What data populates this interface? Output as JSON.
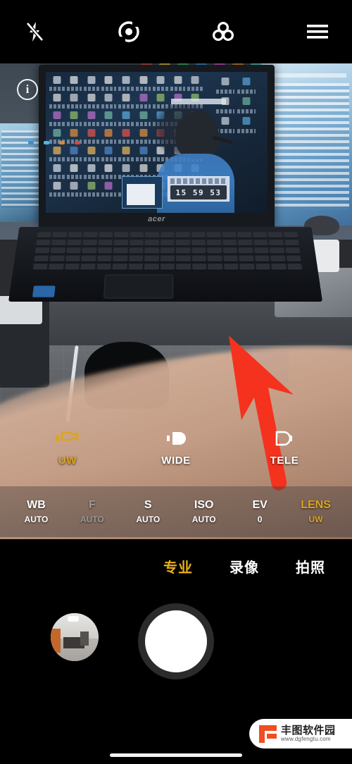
{
  "app": {
    "name": "Camera",
    "mode": "Pro"
  },
  "topbar": {
    "flash": {
      "icon": "flash-off-icon",
      "label": "Flash off"
    },
    "hdr": {
      "icon": "hdr-target-icon",
      "label": "HDR"
    },
    "filter": {
      "icon": "color-filter-icon",
      "label": "Filters"
    },
    "menu": {
      "icon": "hamburger-menu-icon",
      "label": "Settings"
    }
  },
  "viewfinder": {
    "info_badge": "i",
    "scene": {
      "laptop_brand": "acer",
      "clock_widget": "15 59 53",
      "annotation": {
        "type": "arrow",
        "color": "#f5321e",
        "direction": "up-left"
      }
    }
  },
  "lens_selector": {
    "items": [
      {
        "id": "uw",
        "label": "UW",
        "icon": "lens-ultrawide-icon",
        "active": true
      },
      {
        "id": "wide",
        "label": "WIDE",
        "icon": "lens-wide-icon",
        "active": false
      },
      {
        "id": "tele",
        "label": "TELE",
        "icon": "lens-tele-icon",
        "active": false
      }
    ],
    "accent_color": "#d9a520"
  },
  "pro_controls": {
    "items": [
      {
        "id": "wb",
        "key": "WB",
        "value": "AUTO",
        "state": "normal"
      },
      {
        "id": "f",
        "key": "F",
        "value": "AUTO",
        "state": "disabled"
      },
      {
        "id": "s",
        "key": "S",
        "value": "AUTO",
        "state": "normal"
      },
      {
        "id": "iso",
        "key": "ISO",
        "value": "AUTO",
        "state": "normal"
      },
      {
        "id": "ev",
        "key": "EV",
        "value": "0",
        "state": "normal"
      },
      {
        "id": "lens",
        "key": "LENS",
        "value": "UW",
        "state": "active"
      }
    ]
  },
  "mode_tabs": [
    {
      "id": "pro",
      "label": "专业",
      "active": true
    },
    {
      "id": "video",
      "label": "录像",
      "active": false
    },
    {
      "id": "photo",
      "label": "拍照",
      "active": false
    }
  ],
  "shutter_bar": {
    "thumbnail_label": "Last photo",
    "shutter_label": "Capture"
  },
  "watermark": {
    "name": "丰图软件园",
    "url": "www.dgfengtu.com",
    "logo_color": "#f04d20"
  },
  "system": {
    "home_indicator": "home-indicator"
  },
  "colors": {
    "accent_gold": "#d9a520",
    "tab_gold": "#e8b017",
    "arrow_red": "#f5321e",
    "background": "#000000"
  }
}
